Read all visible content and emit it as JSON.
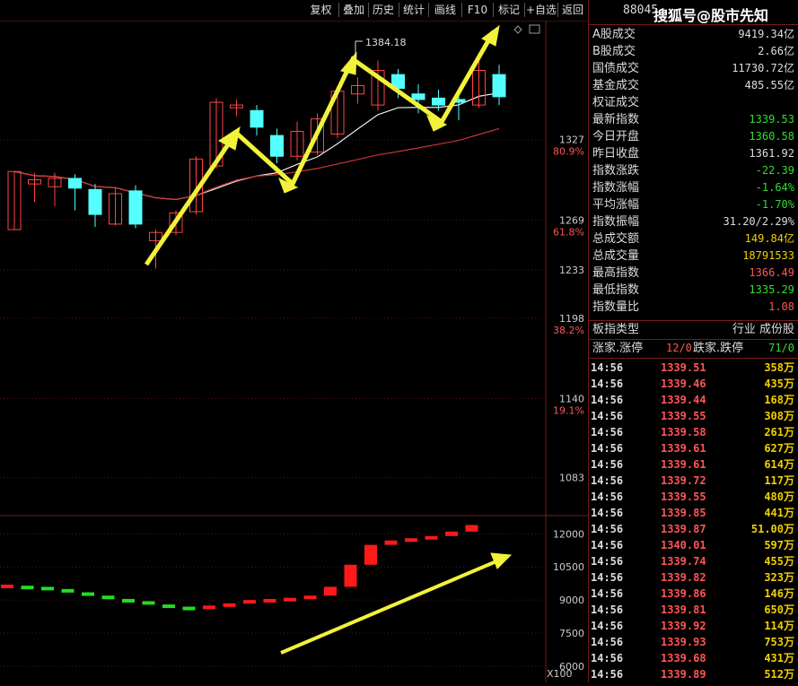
{
  "toolbar": {
    "buttons": [
      "复权",
      "叠加",
      "历史",
      "统计",
      "画线",
      "F10",
      "标记",
      "+自选",
      "返回"
    ]
  },
  "chart": {
    "price_axis": [
      {
        "price": "1327",
        "pct": "80.9%"
      },
      {
        "price": "1269",
        "pct": "61.8%"
      },
      {
        "price": "1233",
        "pct": ""
      },
      {
        "price": "1198",
        "pct": "38.2%"
      },
      {
        "price": "1140",
        "pct": "19.1%"
      },
      {
        "price": "1083",
        "pct": ""
      }
    ],
    "high_label": "1384.18",
    "volume_axis": [
      "12000",
      "10500",
      "9000",
      "7500",
      "6000"
    ],
    "volume_unit": "X100"
  },
  "quote": {
    "code": "88045",
    "watermark": "搜狐号@股市先知",
    "rows": [
      {
        "label": "A股成交",
        "value": "9419.34亿",
        "color": "#dddddd"
      },
      {
        "label": "B股成交",
        "value": "2.66亿",
        "color": "#dddddd"
      },
      {
        "label": "国债成交",
        "value": "11730.72亿",
        "color": "#dddddd"
      },
      {
        "label": "基金成交",
        "value": "485.55亿",
        "color": "#dddddd"
      },
      {
        "label": "权证成交",
        "value": "",
        "color": "#dddddd"
      },
      {
        "label": "最新指数",
        "value": "1339.53",
        "color": "#33dd33"
      },
      {
        "label": "今日开盘",
        "value": "1360.58",
        "color": "#33dd33"
      },
      {
        "label": "昨日收盘",
        "value": "1361.92",
        "color": "#dddddd"
      },
      {
        "label": "指数涨跌",
        "value": "-22.39",
        "color": "#33dd33"
      },
      {
        "label": "指数涨幅",
        "value": "-1.64%",
        "color": "#33dd33"
      },
      {
        "label": "平均涨幅",
        "value": "-1.70%",
        "color": "#33dd33"
      },
      {
        "label": "指数振幅",
        "value": "31.20/2.29%",
        "color": "#dddddd"
      },
      {
        "label": "总成交额",
        "value": "149.84亿",
        "color": "#f0d000"
      },
      {
        "label": "总成交量",
        "value": "18791533",
        "color": "#f0d000"
      },
      {
        "label": "最高指数",
        "value": "1366.49",
        "color": "#ff5555"
      },
      {
        "label": "最低指数",
        "value": "1335.29",
        "color": "#33dd33"
      },
      {
        "label": "指数量比",
        "value": "1.08",
        "color": "#ff5555"
      }
    ],
    "sector_label": "板指类型",
    "sector_value": "行业 成份股",
    "up_label": "涨家.涨停",
    "up_value": "12/0",
    "down_label": "跌家.跌停",
    "down_value": "71/0",
    "ticks": [
      {
        "time": "14:56",
        "price": "1339.51",
        "vol": "358万"
      },
      {
        "time": "14:56",
        "price": "1339.46",
        "vol": "435万"
      },
      {
        "time": "14:56",
        "price": "1339.44",
        "vol": "168万"
      },
      {
        "time": "14:56",
        "price": "1339.55",
        "vol": "308万"
      },
      {
        "time": "14:56",
        "price": "1339.58",
        "vol": "261万"
      },
      {
        "time": "14:56",
        "price": "1339.61",
        "vol": "627万"
      },
      {
        "time": "14:56",
        "price": "1339.61",
        "vol": "614万"
      },
      {
        "time": "14:56",
        "price": "1339.72",
        "vol": "117万"
      },
      {
        "time": "14:56",
        "price": "1339.55",
        "vol": "480万"
      },
      {
        "time": "14:56",
        "price": "1339.85",
        "vol": "441万"
      },
      {
        "time": "14:56",
        "price": "1339.87",
        "vol": "51.00万"
      },
      {
        "time": "14:56",
        "price": "1340.01",
        "vol": "597万"
      },
      {
        "time": "14:56",
        "price": "1339.74",
        "vol": "455万"
      },
      {
        "time": "14:56",
        "price": "1339.82",
        "vol": "323万"
      },
      {
        "time": "14:56",
        "price": "1339.86",
        "vol": "146万"
      },
      {
        "time": "14:56",
        "price": "1339.81",
        "vol": "650万"
      },
      {
        "time": "14:56",
        "price": "1339.92",
        "vol": "114万"
      },
      {
        "time": "14:56",
        "price": "1339.93",
        "vol": "753万"
      },
      {
        "time": "14:56",
        "price": "1339.68",
        "vol": "431万"
      },
      {
        "time": "14:56",
        "price": "1339.89",
        "vol": "512万"
      }
    ]
  },
  "chart_data": {
    "type": "candlestick",
    "ylim": [
      1060,
      1400
    ],
    "candles": [
      {
        "o": 1262,
        "c": 1304,
        "h": 1304,
        "l": 1262,
        "dir": "up"
      },
      {
        "o": 1295,
        "c": 1298,
        "h": 1303,
        "l": 1282,
        "dir": "up"
      },
      {
        "o": 1293,
        "c": 1299,
        "h": 1303,
        "l": 1279,
        "dir": "up"
      },
      {
        "o": 1299,
        "c": 1292,
        "h": 1302,
        "l": 1276,
        "dir": "down"
      },
      {
        "o": 1291,
        "c": 1273,
        "h": 1295,
        "l": 1264,
        "dir": "down"
      },
      {
        "o": 1266,
        "c": 1288,
        "h": 1292,
        "l": 1265,
        "dir": "up"
      },
      {
        "o": 1290,
        "c": 1266,
        "h": 1294,
        "l": 1263,
        "dir": "down"
      },
      {
        "o": 1254,
        "c": 1260,
        "h": 1262,
        "l": 1234,
        "dir": "up"
      },
      {
        "o": 1260,
        "c": 1274,
        "h": 1276,
        "l": 1258,
        "dir": "up"
      },
      {
        "o": 1275,
        "c": 1313,
        "h": 1315,
        "l": 1273,
        "dir": "up"
      },
      {
        "o": 1308,
        "c": 1354,
        "h": 1357,
        "l": 1306,
        "dir": "up"
      },
      {
        "o": 1350,
        "c": 1352,
        "h": 1356,
        "l": 1344,
        "dir": "up"
      },
      {
        "o": 1348,
        "c": 1336,
        "h": 1352,
        "l": 1330,
        "dir": "down"
      },
      {
        "o": 1330,
        "c": 1315,
        "h": 1335,
        "l": 1310,
        "dir": "down"
      },
      {
        "o": 1315,
        "c": 1333,
        "h": 1340,
        "l": 1312,
        "dir": "up"
      },
      {
        "o": 1318,
        "c": 1342,
        "h": 1346,
        "l": 1316,
        "dir": "up"
      },
      {
        "o": 1331,
        "c": 1362,
        "h": 1364,
        "l": 1328,
        "dir": "up"
      },
      {
        "o": 1360,
        "c": 1366,
        "h": 1372,
        "l": 1353,
        "dir": "up"
      },
      {
        "o": 1352,
        "c": 1377,
        "h": 1384.18,
        "l": 1348,
        "dir": "up"
      },
      {
        "o": 1374,
        "c": 1364,
        "h": 1378,
        "l": 1357,
        "dir": "down"
      },
      {
        "o": 1360,
        "c": 1356,
        "h": 1367,
        "l": 1346,
        "dir": "down"
      },
      {
        "o": 1357,
        "c": 1352,
        "h": 1363,
        "l": 1348,
        "dir": "down"
      },
      {
        "o": 1356,
        "c": 1354,
        "h": 1360,
        "l": 1341,
        "dir": "down"
      },
      {
        "o": 1352,
        "c": 1377,
        "h": 1385,
        "l": 1350,
        "dir": "up"
      },
      {
        "o": 1374,
        "c": 1358,
        "h": 1381,
        "l": 1352,
        "dir": "down"
      }
    ],
    "volume": [
      9700,
      9650,
      9600,
      9500,
      9350,
      9200,
      9050,
      8950,
      8800,
      8700,
      8750,
      8850,
      9000,
      9050,
      9100,
      9200,
      9600,
      10600,
      11500,
      11700,
      11800,
      11900,
      12100,
      12400
    ]
  }
}
